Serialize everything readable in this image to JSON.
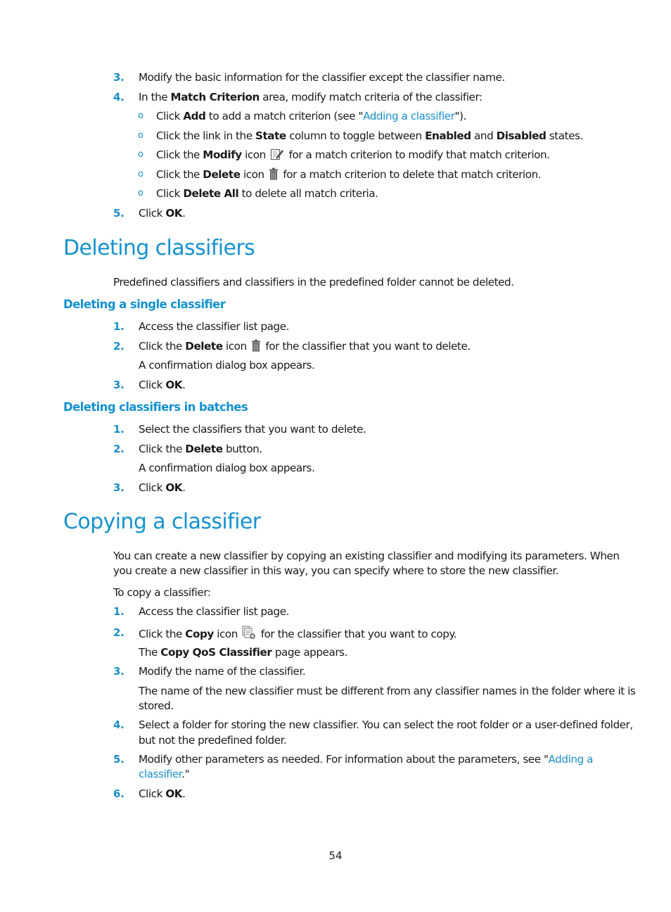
{
  "continued_steps": [
    {
      "num": "3.",
      "text": "Modify the basic information for the classifier except the classifier name."
    },
    {
      "num": "4.",
      "pre": "In the ",
      "bold": "Match Criterion",
      "post": " area, modify match criteria of the classifier:"
    },
    {
      "num": "5.",
      "pre": "Click ",
      "bold": "OK",
      "post": "."
    }
  ],
  "sub_items": [
    {
      "pre": "Click ",
      "bold": "Add",
      "mid": " to add a match criterion (see \"",
      "link": "Adding a classifier",
      "post": "\")."
    },
    {
      "pre": "Click the link in the ",
      "bold": "State",
      "mid": " column to toggle between ",
      "bold2": "Enabled",
      "mid2": " and ",
      "bold3": "Disabled",
      "post": " states."
    },
    {
      "pre": "Click the ",
      "bold": "Modify",
      "mid": " icon",
      "icon": "edit-icon",
      "post": " for a match criterion to modify that match criterion."
    },
    {
      "pre": "Click the ",
      "bold": "Delete",
      "mid": " icon",
      "icon": "trash-icon",
      "post": " for a match criterion to delete that match criterion."
    },
    {
      "pre": "Click ",
      "bold": "Delete All",
      "post": " to delete all match criteria."
    }
  ],
  "bullet_glyph": "o",
  "section_deleting": {
    "title": "Deleting classifiers",
    "intro": "Predefined classifiers and classifiers in the predefined folder cannot be deleted.",
    "single": {
      "title": "Deleting a single classifier",
      "steps": [
        {
          "num": "1.",
          "text": "Access the classifier list page."
        },
        {
          "num": "2.",
          "pre": "Click the ",
          "bold": "Delete",
          "mid": " icon",
          "icon": "trash-icon",
          "post": " for the classifier that you want to delete."
        },
        {
          "note": "A confirmation dialog box appears."
        },
        {
          "num": "3.",
          "pre": "Click ",
          "bold": "OK",
          "post": "."
        }
      ]
    },
    "batches": {
      "title": "Deleting classifiers in batches",
      "steps": [
        {
          "num": "1.",
          "text": "Select the classifiers that you want to delete."
        },
        {
          "num": "2.",
          "pre": "Click the ",
          "bold": "Delete",
          "post": " button."
        },
        {
          "note": "A confirmation dialog box appears."
        },
        {
          "num": "3.",
          "pre": "Click ",
          "bold": "OK",
          "post": "."
        }
      ]
    }
  },
  "section_copying": {
    "title": "Copying a classifier",
    "intro_line1": "You can create a new classifier by copying an existing classifier and modifying its parameters. When",
    "intro_line2": "you create a new classifier in this way, you can specify where to store the new classifier.",
    "lead": "To copy a classifier:",
    "steps": [
      {
        "num": "1.",
        "text": "Access the classifier list page."
      },
      {
        "num": "2.",
        "pre": "Click the ",
        "bold": "Copy",
        "mid": " icon",
        "icon": "copy-icon",
        "post": " for the classifier that you want to copy."
      },
      {
        "note_pre": "The ",
        "note_bold": "Copy QoS Classifier",
        "note_post": " page appears."
      },
      {
        "num": "3.",
        "text": "Modify the name of the classifier."
      },
      {
        "note_line1": "The name of the new classifier must be different from any classifier names in the folder where it is",
        "note_line2": "stored."
      },
      {
        "num": "4.",
        "line1": "Select a folder for storing the new classifier. You can select the root folder or a user-defined folder,",
        "line2": "but not the predefined folder."
      },
      {
        "num": "5.",
        "line1_pre": "Modify other parameters as needed. For information about the parameters, see \"",
        "line1_link": "Adding a",
        "line2_link": "classifier",
        "line2_post": ".\""
      },
      {
        "num": "6.",
        "pre": "Click ",
        "bold": "OK",
        "post": "."
      }
    ]
  },
  "page_number": "54",
  "colors": {
    "accent": "#1592cf",
    "text": "#1a1a1a"
  }
}
